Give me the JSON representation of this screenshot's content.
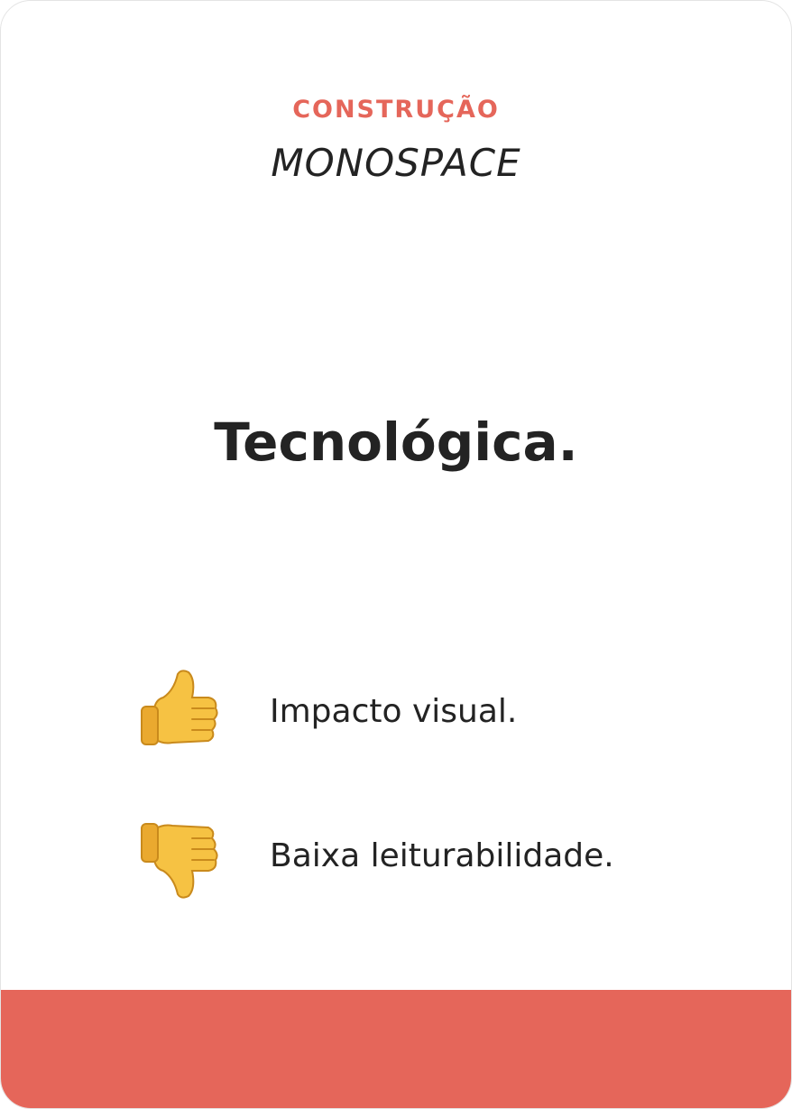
{
  "card": {
    "category": "CONSTRUÇÃO",
    "subtitle": "MONOSPACE",
    "headline": "Tecnológica.",
    "pro": {
      "icon": "thumbs-up-icon",
      "label": "Impacto visual."
    },
    "con": {
      "icon": "thumbs-down-icon",
      "label": "Baixa leiturabilidade."
    }
  },
  "colors": {
    "accent": "#e5665a",
    "text": "#232323",
    "background": "#ffffff",
    "emoji_yellow": "#f6c243"
  }
}
